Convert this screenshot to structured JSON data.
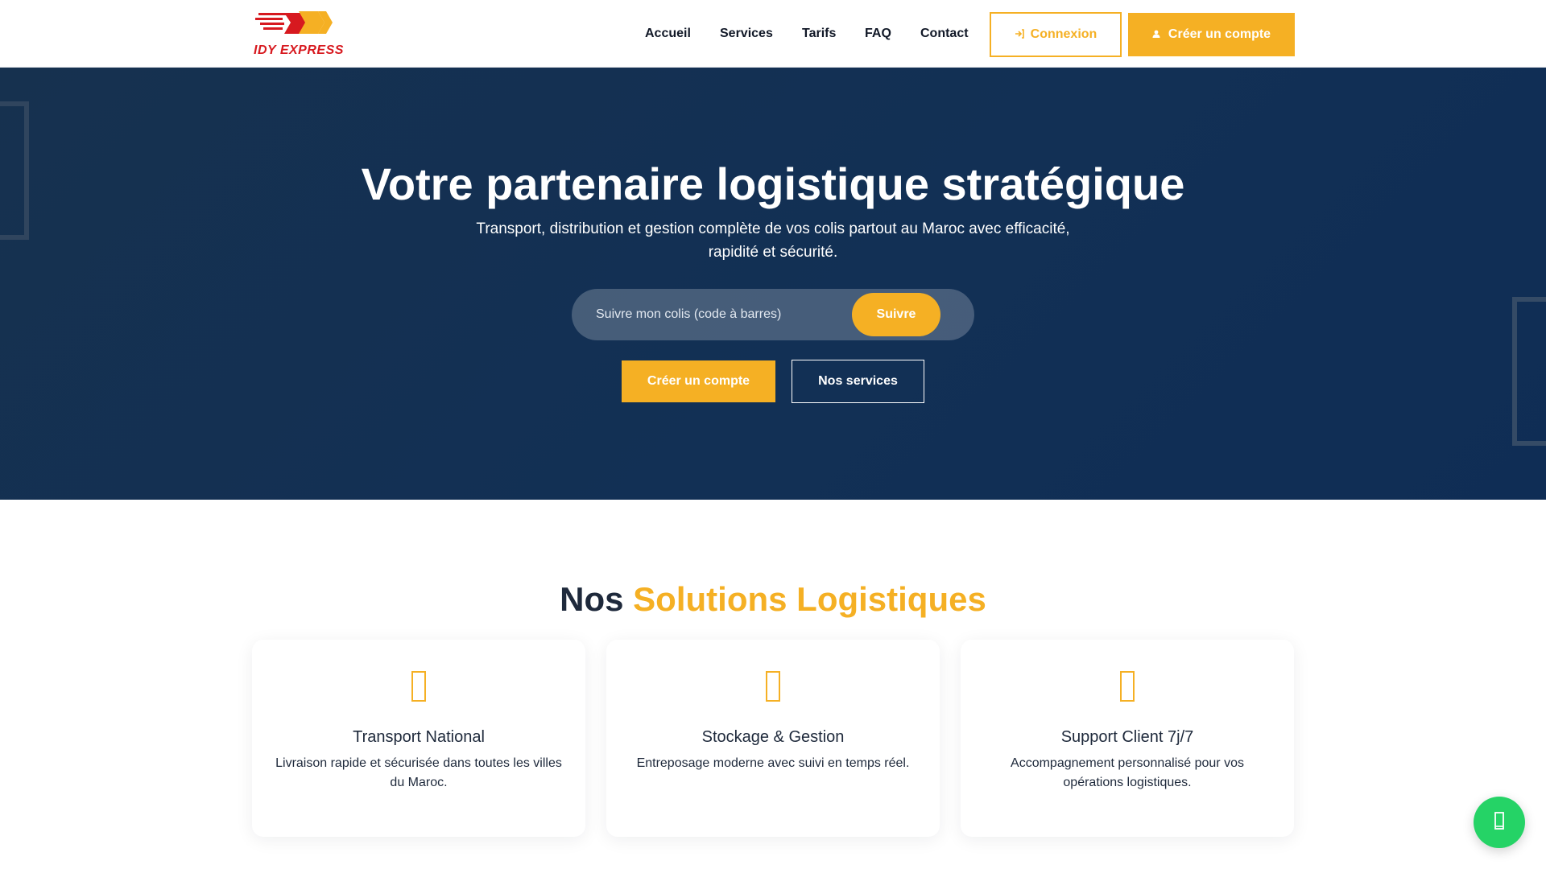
{
  "brand": {
    "name": "IDY EXPRESS",
    "red": "#d7191f",
    "gold": "#f5b024"
  },
  "nav": {
    "links": [
      {
        "label": "Accueil"
      },
      {
        "label": "Services"
      },
      {
        "label": "Tarifs"
      },
      {
        "label": "FAQ"
      },
      {
        "label": "Contact"
      }
    ],
    "login_label": "Connexion",
    "login_icon": "sign-in-icon",
    "signup_label": "Créer un compte",
    "signup_icon": "user-plus-icon"
  },
  "hero": {
    "title": "Votre partenaire logistique stratégique",
    "subtitle": "Transport, distribution et gestion complète de vos colis partout au Maroc avec efficacité, rapidité et sécurité.",
    "tracking": {
      "placeholder": "Suivre mon colis (code à barres)",
      "button": "Suivre"
    },
    "primary_button": "Créer un compte",
    "secondary_button": "Nos services",
    "bg_color": "#14325a"
  },
  "solutions": {
    "title_main": "Nos",
    "title_accent": "Solutions Logistiques",
    "cards": [
      {
        "icon": "truck-icon",
        "title": "Transport National",
        "description": "Livraison rapide et sécurisée dans toutes les villes du Maroc."
      },
      {
        "icon": "warehouse-icon",
        "title": "Stockage & Gestion",
        "description": "Entreposage moderne avec suivi en temps réel."
      },
      {
        "icon": "headset-icon",
        "title": "Support Client 7j/7",
        "description": "Accompagnement personnalisé pour vos opérations logistiques."
      }
    ]
  },
  "whatsapp": {
    "icon": "whatsapp-icon",
    "color": "#25d366"
  }
}
